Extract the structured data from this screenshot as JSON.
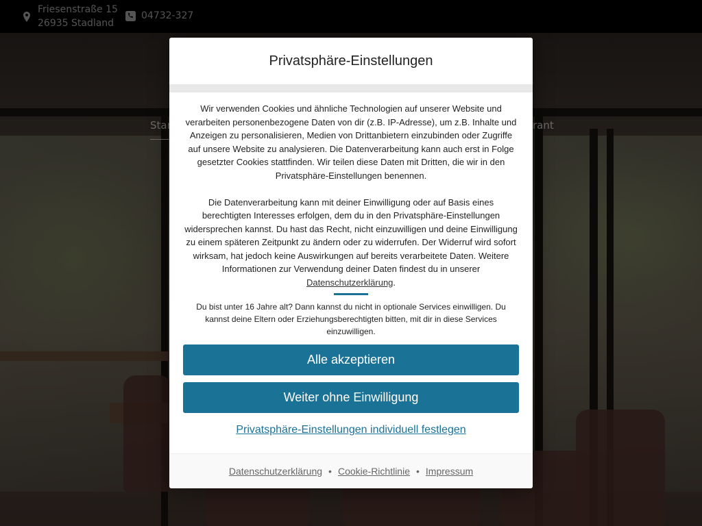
{
  "topbar": {
    "address_line1": "Friesenstraße 15",
    "address_line2": "26935 Stadland",
    "phone": "04732-327",
    "address_icon": "map-pin-icon",
    "phone_icon": "phone-icon"
  },
  "nav": {
    "item_left": "Star",
    "item_right": "rant"
  },
  "modal": {
    "title": "Privatsphäre-Einstellungen",
    "paragraph1": "Wir verwenden Cookies und ähnliche Technologien auf unserer Website und verarbeiten personenbezogene Daten von dir (z.B. IP-Adresse), um z.B. Inhalte und Anzeigen zu personalisieren, Medien von Drittanbietern einzubinden oder Zugriffe auf unsere Website zu analysieren. Die Datenverarbeitung kann auch erst in Folge gesetzter Cookies stattfinden. Wir teilen diese Daten mit Dritten, die wir in den Privatsphäre-Einstellungen benennen.",
    "paragraph2_text": "Die Datenverarbeitung kann mit deiner Einwilligung oder auf Basis eines berechtigten Interesses erfolgen, dem du in den Privatsphäre-Einstellungen widersprechen kannst. Du hast das Recht, nicht einzuwilligen und deine Einwilligung zu einem späteren Zeitpunkt zu ändern oder zu widerrufen. Der Widerruf wird sofort wirksam, hat jedoch keine Auswirkungen auf bereits verarbeitete Daten. Weitere Informationen zur Verwendung deiner Daten findest du in unserer",
    "paragraph2_link": "Datenschutzerklärung",
    "paragraph2_end": ".",
    "age_note": "Du bist unter 16 Jahre alt? Dann kannst du nicht in optionale Services einwilligen. Du kannst deine Eltern oder Erziehungsberechtigten bitten, mit dir in diese Services einzuwilligen.",
    "accept_all": "Alle akzeptieren",
    "continue_without": "Weiter ohne Einwilligung",
    "individual_settings": "Privatsphäre-Einstellungen individuell festlegen",
    "footer": {
      "privacy": "Datenschutzerklärung",
      "cookie_policy": "Cookie-Richtlinie",
      "imprint": "Impressum",
      "separator": "•"
    }
  },
  "colors": {
    "accent": "#1a7296",
    "topbar_bg": "#000000"
  }
}
